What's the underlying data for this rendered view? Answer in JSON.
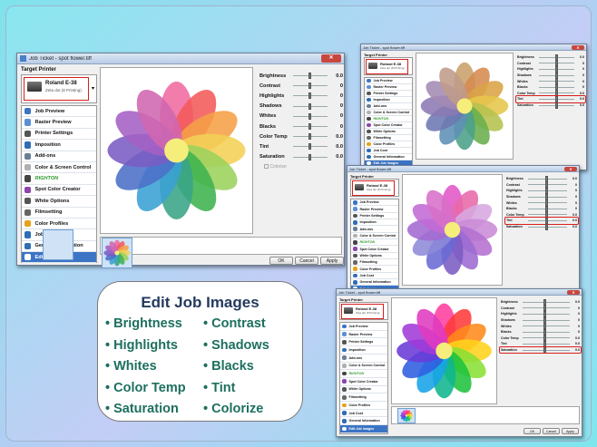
{
  "main": {
    "title": "Job Ticket - spot flower.tiff",
    "target_printer_label": "Target Printer",
    "printer_name": "Roland E-38",
    "printer_sub": "Zeta dot (8 Printing)",
    "nav": [
      {
        "label": "Job Preview",
        "icon": "job-preview-icon",
        "color": "#3b74c5"
      },
      {
        "label": "Raster Preview",
        "icon": "raster-preview-icon",
        "color": "#5b8fd6"
      },
      {
        "label": "Printer Settings",
        "icon": "printer-icon",
        "color": "#555"
      },
      {
        "label": "Imposition",
        "icon": "imposition-icon",
        "color": "#2f6db5"
      },
      {
        "label": "Add-ons",
        "icon": "add-ons-icon",
        "color": "#6a7f96"
      },
      {
        "label": "Color & Screen Control",
        "icon": "color-screen-icon",
        "color": "#b0b0b0"
      },
      {
        "label": "RIGHTON",
        "icon": "righton-logo-icon",
        "color": "#444"
      },
      {
        "label": "Spot Color Creator",
        "icon": "spot-color-icon",
        "color": "#8e44ad"
      },
      {
        "label": "White Options",
        "icon": "white-options-icon",
        "color": "#555"
      },
      {
        "label": "Filmsetting",
        "icon": "filmsetting-icon",
        "color": "#666"
      },
      {
        "label": "Color Profiles",
        "icon": "color-profiles-icon",
        "color": "#e6a21a"
      },
      {
        "label": "Job Cost",
        "icon": "dollar-icon",
        "color": "#2f6db5"
      },
      {
        "label": "General Information",
        "icon": "info-icon",
        "color": "#2f6db5"
      },
      {
        "label": "Edit Job Images",
        "icon": "edit-images-icon",
        "color": "#ffffff"
      }
    ],
    "adjustments": [
      {
        "label": "Brightness",
        "value": "0.0"
      },
      {
        "label": "Contrast",
        "value": "0"
      },
      {
        "label": "Highlights",
        "value": "0"
      },
      {
        "label": "Shadows",
        "value": "0"
      },
      {
        "label": "Whites",
        "value": "0"
      },
      {
        "label": "Blacks",
        "value": "0"
      },
      {
        "label": "Color Temp",
        "value": "0.0"
      },
      {
        "label": "Tint",
        "value": "0.0"
      },
      {
        "label": "Saturation",
        "value": "0.0"
      }
    ],
    "colorize_label": "Colorize",
    "buttons": {
      "ok": "OK",
      "cancel": "Cancel",
      "apply": "Apply"
    }
  },
  "small_windows": [
    {
      "title": "Job Ticket - spot flower.tiff",
      "highlight": "Tint",
      "flower": "muted"
    },
    {
      "title": "Job Ticket - spot flower.tiff",
      "highlight": "Tint",
      "flower": "purple"
    },
    {
      "title": "Job Ticket - spot flower.tiff",
      "highlight": "Saturation",
      "flower": "vivid"
    }
  ],
  "card": {
    "title": "Edit Job Images",
    "left": [
      "Brightness",
      "Highlights",
      "Whites",
      "Color Temp",
      "Saturation"
    ],
    "right": [
      "Contrast",
      "Shadows",
      "Blacks",
      "Tint",
      "Colorize"
    ]
  },
  "colors": {
    "accent": "#3b74c5",
    "highlight": "#d81e1e",
    "bullet": "#1d6f5f",
    "card_title": "#243a5e"
  }
}
